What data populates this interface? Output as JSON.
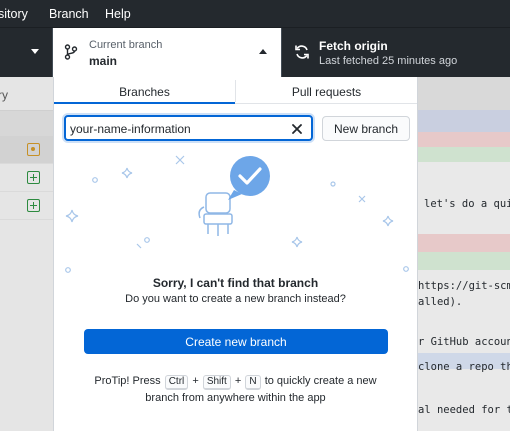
{
  "menubar": {
    "items": [
      "sitory",
      "Branch",
      "Help"
    ]
  },
  "toolbar": {
    "current_branch_label": "Current branch",
    "current_branch_value": "main",
    "fetch_title": "Fetch origin",
    "fetch_subtitle": "Last fetched 25 minutes ago"
  },
  "left_pane": {
    "header": "ry",
    "files": [
      {
        "status": "modified"
      },
      {
        "status": "added"
      },
      {
        "status": "added"
      }
    ]
  },
  "right_pane": {
    "lines": [
      "let's do a qui",
      "https://git-scm",
      "alled).",
      "r GitHub account",
      "clone a repo th",
      "al needed for t"
    ]
  },
  "dropdown": {
    "tabs": [
      {
        "label": "Branches",
        "active": true
      },
      {
        "label": "Pull requests",
        "active": false
      }
    ],
    "filter_value": "your-name-information",
    "new_branch_label": "New branch",
    "empty_title": "Sorry, I can't find that branch",
    "empty_subtitle": "Do you want to create a new branch instead?",
    "create_button_label": "Create new branch",
    "protip": {
      "prefix": "ProTip! Press",
      "key_ctrl": "Ctrl",
      "plus1": "+",
      "key_shift": "Shift",
      "plus2": "+",
      "key_n": "N",
      "middle": "to quickly create a new",
      "line2": "branch from anywhere within the app"
    }
  },
  "colors": {
    "accent": "#0366d6",
    "toolbar_bg": "#24292e",
    "added": "#2c8a3f",
    "modified": "#c69026"
  }
}
